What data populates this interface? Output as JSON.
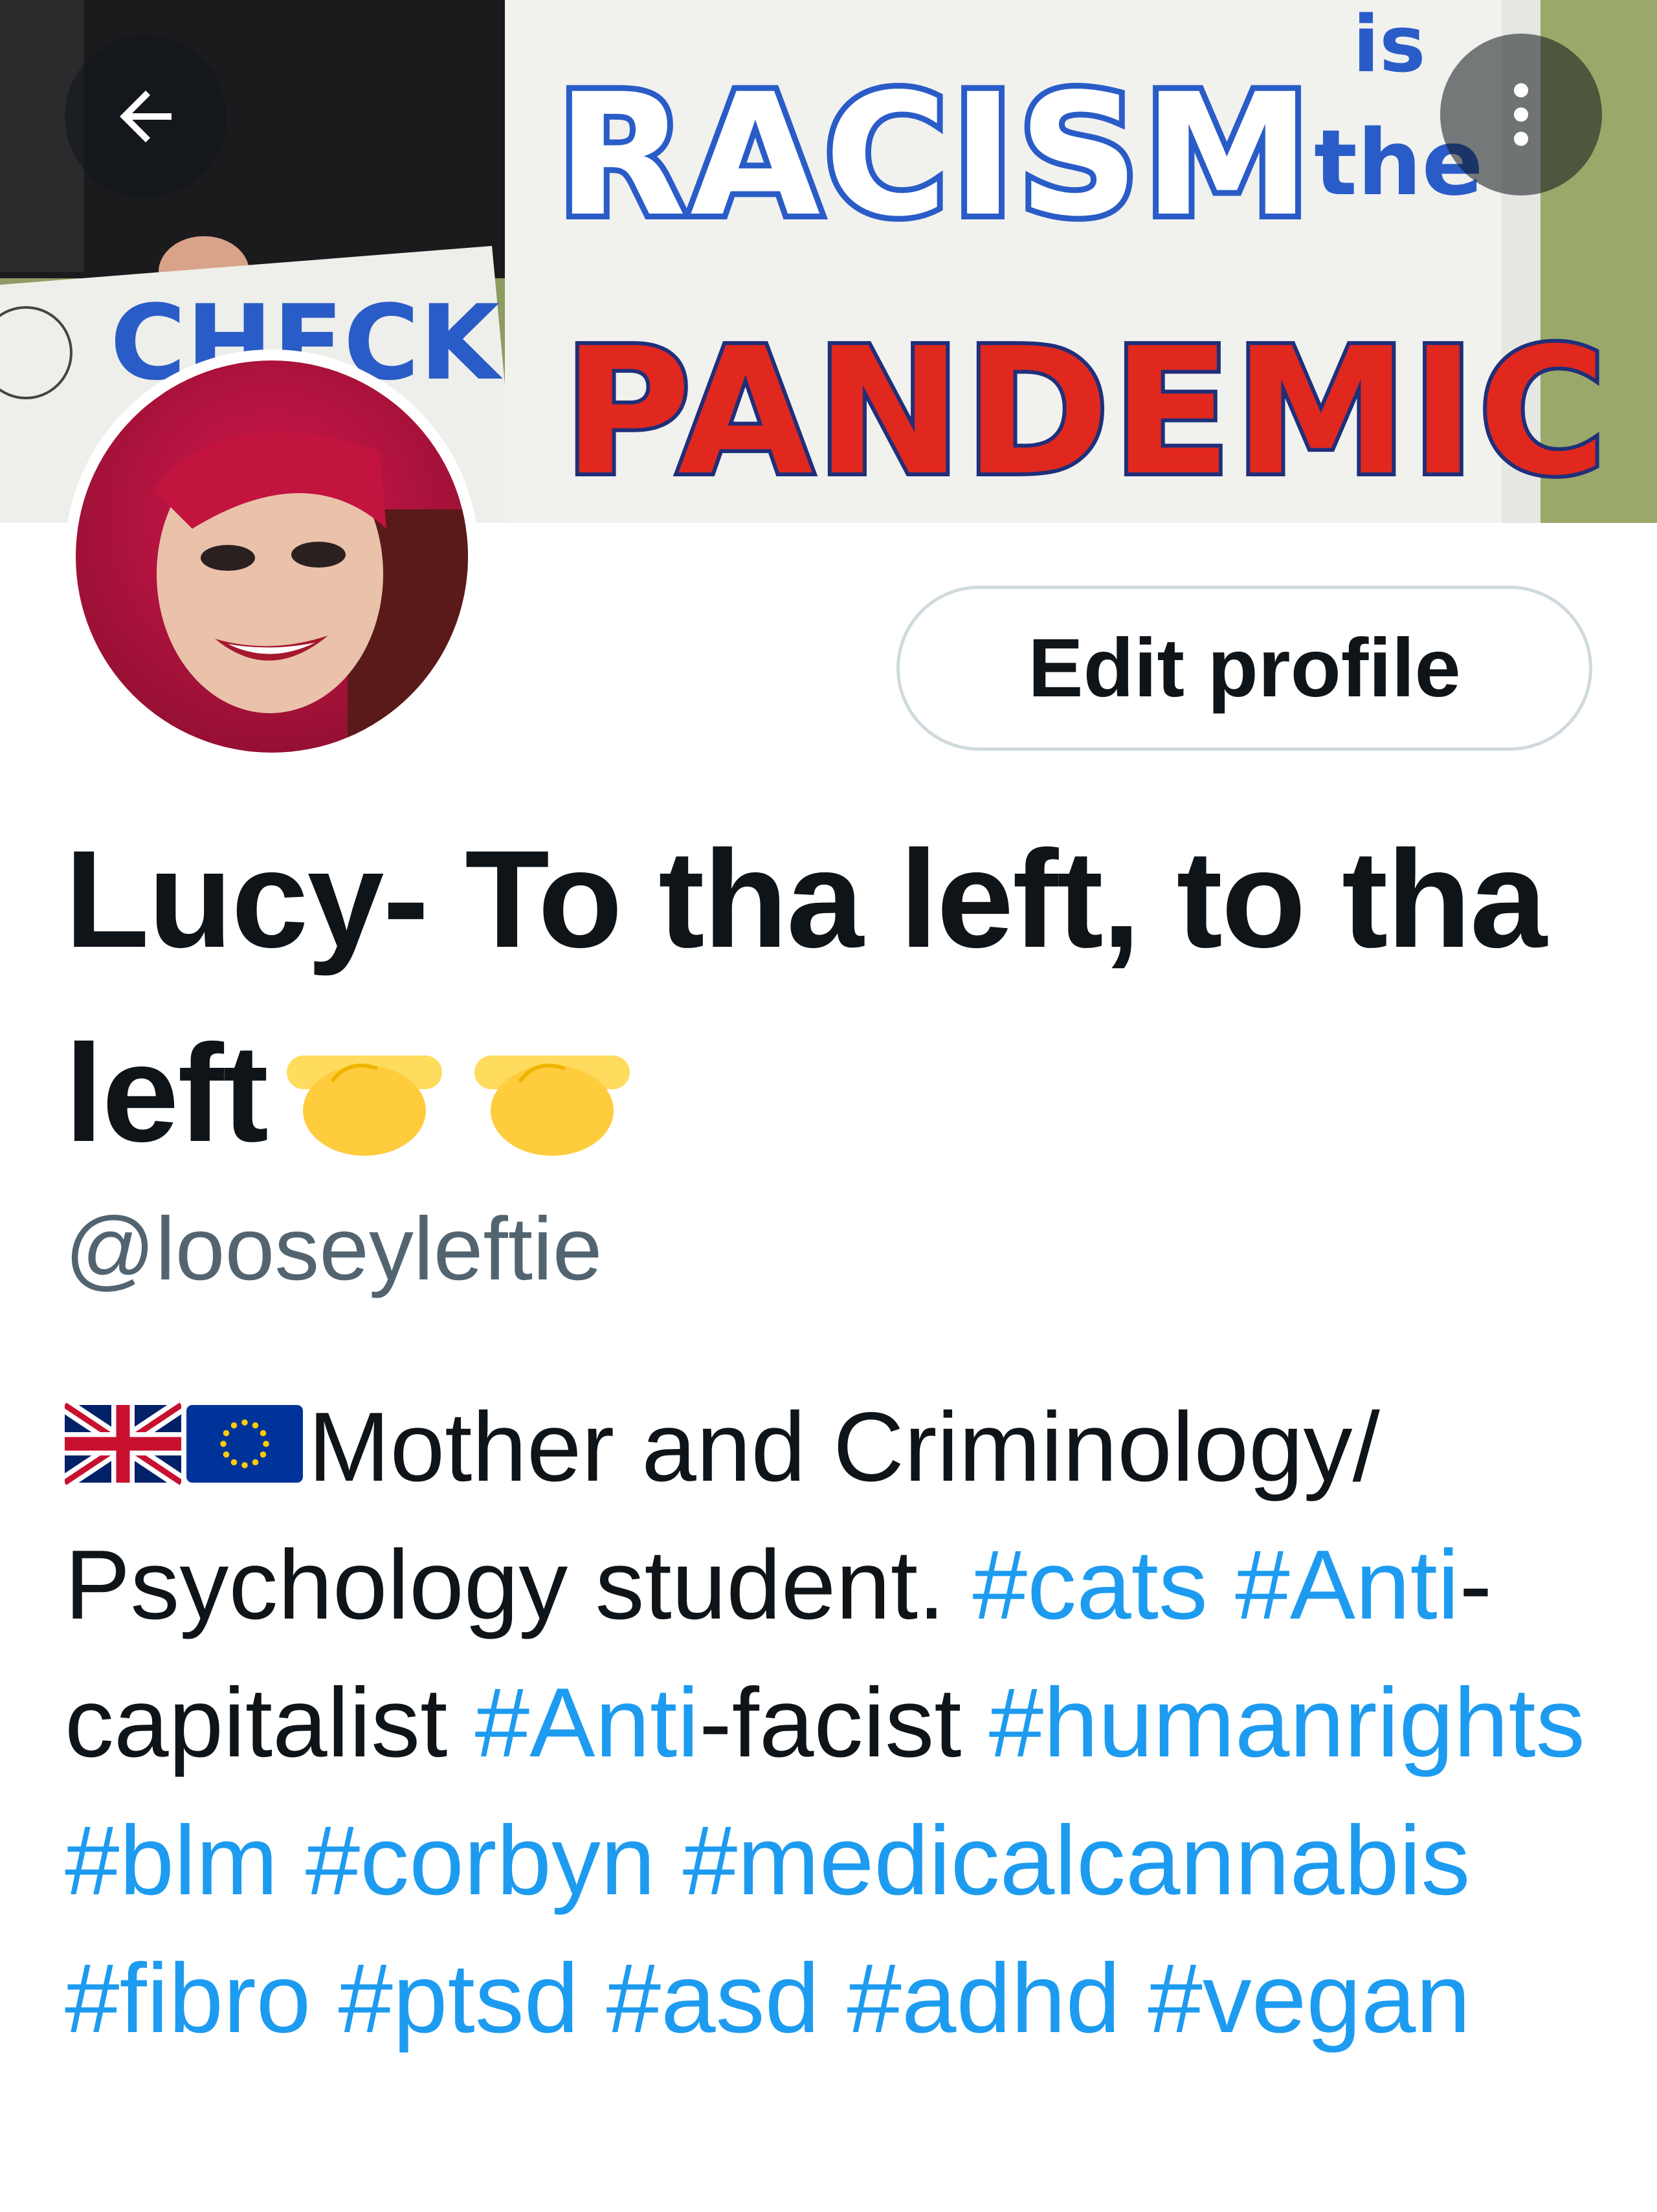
{
  "header": {
    "banner": {
      "sign_main_word": "RACISM",
      "sign_is": "is",
      "sign_the": "the",
      "sign_bottom_word": "PANDEMIC",
      "sign_left_fragment": "CHECK"
    },
    "back_icon": "arrow-left-icon",
    "more_icon": "more-vertical-icon"
  },
  "profile": {
    "edit_button_label": "Edit profile",
    "display_name_text": "Lucy- To tha left, to tha left",
    "display_name_emoji": [
      "backhand-index-pointing-right",
      "backhand-index-pointing-right"
    ],
    "handle": "@looseyleftie",
    "bio": {
      "flags": [
        "uk-flag",
        "eu-flag"
      ],
      "text_1": "Mother and Criminology/ Psychology student. ",
      "tag_cats": "#cats",
      "tag_anti_1": "#Anti",
      "text_2": "-capitalist ",
      "tag_anti_2": "#Anti",
      "text_3": "-facist",
      "tag_humanrights": "#humanrights",
      "tag_blm": "#blm",
      "tag_corbyn": "#corbyn",
      "tag_medicalcannabis": "#medicalcannabis",
      "tag_fibro": "#fibro",
      "tag_ptsd": "#ptsd",
      "tag_asd": "#asd",
      "tag_adhd": "#adhd",
      "tag_vegan": "#vegan"
    }
  },
  "colors": {
    "text_primary": "#0f1419",
    "text_secondary": "#536471",
    "link": "#1d9bf0",
    "button_border": "#cfd9de",
    "sign_blue": "#2a5cc8",
    "sign_red": "#e0281e"
  }
}
